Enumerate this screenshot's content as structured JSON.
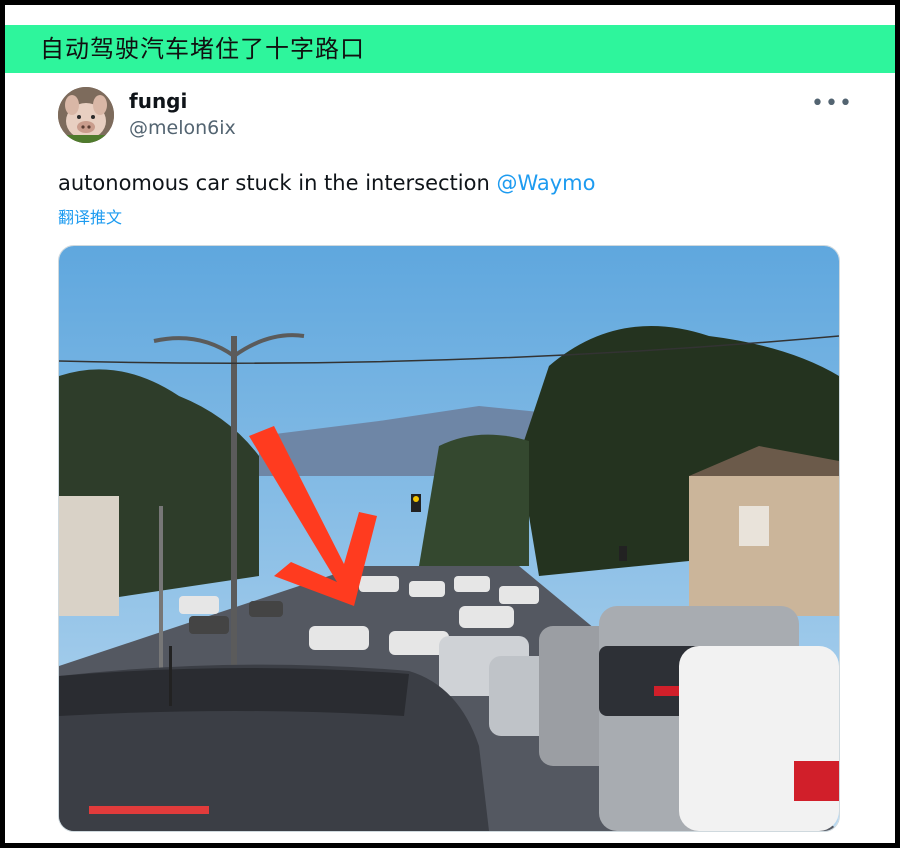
{
  "banner": {
    "title": "自动驾驶汽车堵住了十字路口"
  },
  "tweet": {
    "author": {
      "name": "fungi",
      "handle": "@melon6ix",
      "avatar_icon": "pig-avatar-icon"
    },
    "more_icon": "more-icon",
    "text": "autonomous car stuck in the intersection ",
    "mention": "@Waymo",
    "translate_label": "翻译推文"
  },
  "colors": {
    "banner_bg": "#2ef59c",
    "link": "#1d9bf0",
    "arrow": "#ff3b1f"
  }
}
